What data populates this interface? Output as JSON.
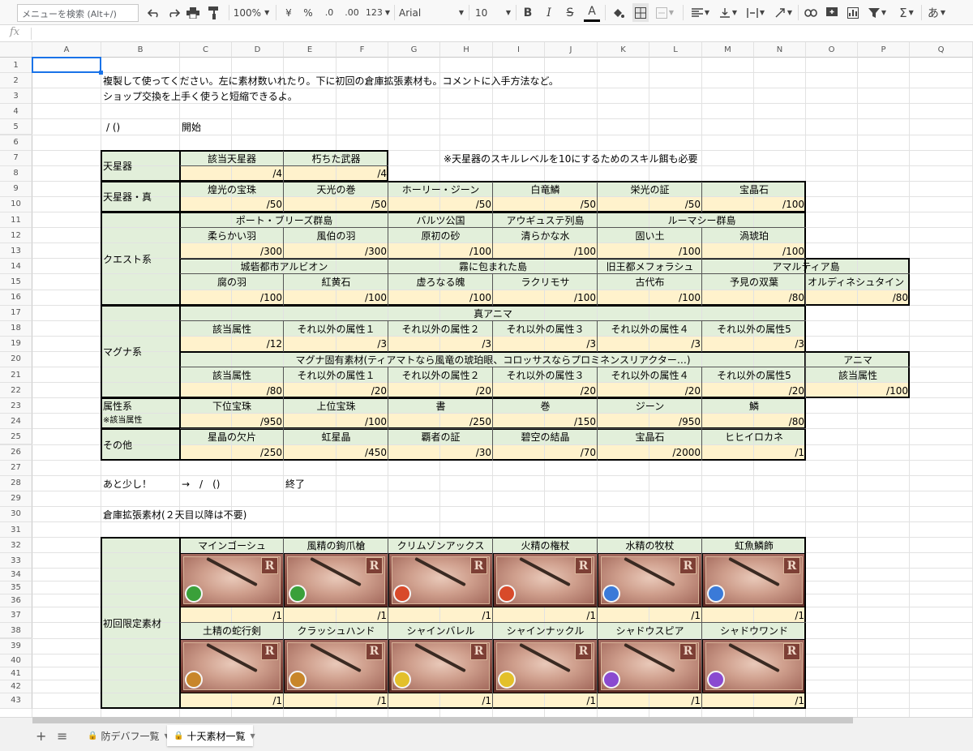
{
  "toolbar": {
    "search_placeholder": "メニューを検索 (Alt+/)",
    "zoom": "100%",
    "currency": "¥",
    "percent": "%",
    "dec_less": ".0",
    "dec_more": ".00",
    "format_more": "123",
    "font": "Arial",
    "font_size": "10",
    "bold": "B",
    "italic": "I",
    "strike": "S",
    "text_color": "A",
    "sigma": "Σ",
    "input_tool": "あ"
  },
  "formula_bar": {
    "fx": "fx"
  },
  "columns": [
    "A",
    "B",
    "C",
    "D",
    "E",
    "F",
    "G",
    "H",
    "I",
    "J",
    "K",
    "L",
    "M",
    "N",
    "O",
    "P",
    "Q"
  ],
  "rows": [
    "1",
    "2",
    "3",
    "4",
    "5",
    "6",
    "7",
    "8",
    "9",
    "10",
    "11",
    "12",
    "13",
    "14",
    "15",
    "16",
    "17",
    "18",
    "19",
    "20",
    "21",
    "22",
    "23",
    "24",
    "25",
    "26",
    "27",
    "28",
    "29",
    "30",
    "31",
    "32",
    "33",
    "34",
    "35",
    "36",
    "37",
    "38",
    "39",
    "40",
    "41",
    "42",
    "43"
  ],
  "cells": {
    "b2": "複製して使ってください。左に素材数いれたり。下に初回の倉庫拡張素材も。コメントに入手方法など。",
    "b3": "ショップ交換を上手く使うと短縮できるよ。",
    "b5": "/ ()",
    "c5": "開始",
    "b7": "天星器",
    "c7": "該当天星器",
    "e7": "朽ちた武器",
    "g7": "※天星器のスキルレベルを10にするためのスキル餌も必要",
    "d8": "/4",
    "f8": "/4",
    "b9": "天星器・真",
    "c9": "煌光の宝珠",
    "e9": "天光の巻",
    "g9": "ホーリー・ジーン",
    "i9": "白竜鱗",
    "k9": "栄光の証",
    "m9": "宝晶石",
    "d10": "/50",
    "f10": "/50",
    "h10": "/50",
    "j10": "/50",
    "l10": "/50",
    "n10": "/100",
    "c11": "ポート・ブリーズ群島",
    "g11": "バルツ公国",
    "i11": "アウギュステ列島",
    "k11": "ルーマシー群島",
    "c12": "柔らかい羽",
    "e12": "風伯の羽",
    "g12": "原初の砂",
    "i12": "清らかな水",
    "k12": "固い土",
    "m12": "渦琥珀",
    "b13": "クエスト系",
    "d13": "/300",
    "f13": "/300",
    "h13": "/100",
    "j13": "/100",
    "l13": "/100",
    "n13": "/100",
    "c14": "城砦都市アルビオン",
    "g14": "霧に包まれた島",
    "k14": "旧王都メフォラシュ",
    "m14": "アマルティア島",
    "c15": "腐の羽",
    "e15": "紅黄石",
    "g15": "虚ろなる魄",
    "i15": "ラクリモサ",
    "k15": "古代布",
    "m15": "予見の双葉",
    "o15": "オルディネシュタイン",
    "d16": "/100",
    "f16": "/100",
    "h16": "/100",
    "j16": "/100",
    "l16": "/100",
    "n16": "/80",
    "p16": "/80",
    "c17": "真アニマ",
    "b18": "マグナ系",
    "c18": "該当属性",
    "e18": "それ以外の属性１",
    "g18": "それ以外の属性２",
    "i18": "それ以外の属性３",
    "k18": "それ以外の属性４",
    "m18": "それ以外の属性5",
    "d19": "/12",
    "f19": "/3",
    "h19": "/3",
    "j19": "/3",
    "l19": "/3",
    "n19": "/3",
    "c20": "マグナ固有素材(ティアマトなら風竜の琥珀眼、コロッサスならプロミネンスリアクター…)",
    "o20": "アニマ",
    "c21": "該当属性",
    "e21": "それ以外の属性１",
    "g21": "それ以外の属性２",
    "i21": "それ以外の属性３",
    "k21": "それ以外の属性４",
    "m21": "それ以外の属性5",
    "o21": "該当属性",
    "d22": "/80",
    "f22": "/20",
    "h22": "/20",
    "j22": "/20",
    "l22": "/20",
    "n22": "/20",
    "p22": "/100",
    "b23": "属性系",
    "b24": "※該当属性",
    "c23": "下位宝珠",
    "e23": "上位宝珠",
    "g23": "書",
    "i23": "巻",
    "k23": "ジーン",
    "m23": "鱗",
    "d24": "/950",
    "f24": "/100",
    "h24": "/250",
    "j24": "/150",
    "l24": "/950",
    "n24": "/80",
    "b25": "その他",
    "c25": "星晶の欠片",
    "e25": "虹星晶",
    "g25": "覇者の証",
    "i25": "碧空の結晶",
    "k25": "宝晶石",
    "m25": "ヒヒイロカネ",
    "d26": "/250",
    "f26": "/450",
    "h26": "/30",
    "j26": "/70",
    "l26": "/2000",
    "n26": "/1",
    "b28": "あと少し！",
    "c28": "→　/　()",
    "e28": "終了",
    "b30": "倉庫拡張素材(２天目以降は不要)",
    "b40": "初回限定素材",
    "c32": "マインゴーシュ",
    "e32": "風精の鉤爪槍",
    "g32": "クリムゾンアックス",
    "i32": "火精の権杖",
    "k32": "水精の牧杖",
    "m32": "虹魚鱗飾",
    "d37": "/1",
    "f37": "/1",
    "h37": "/1",
    "j37": "/1",
    "l37": "/1",
    "n37": "/1",
    "c38": "土精の蛇行剣",
    "e38": "クラッシュハンド",
    "g38": "シャインバレル",
    "i38": "シャインナックル",
    "k38": "シャドウスピア",
    "m38": "シャドウワンド",
    "d43": "/1",
    "f43": "/1",
    "h43": "/1",
    "j43": "/1",
    "l43": "/1",
    "n43": "/1"
  },
  "rank_letter": "R",
  "weapon_icons_row1": [
    {
      "icon": "mainгauche-weapon-icon",
      "element": "wind",
      "color": "#3aa03a"
    },
    {
      "icon": "spear-weapon-icon",
      "element": "wind",
      "color": "#3aa03a"
    },
    {
      "icon": "axe-weapon-icon",
      "element": "fire",
      "color": "#d84a2a"
    },
    {
      "icon": "staff-weapon-icon",
      "element": "fire",
      "color": "#d84a2a"
    },
    {
      "icon": "staff-weapon-icon",
      "element": "water",
      "color": "#3a7ad8"
    },
    {
      "icon": "gun-weapon-icon",
      "element": "water",
      "color": "#3a7ad8"
    }
  ],
  "weapon_icons_row2": [
    {
      "icon": "sword-weapon-icon",
      "element": "earth",
      "color": "#c8862a"
    },
    {
      "icon": "gauntlet-weapon-icon",
      "element": "earth",
      "color": "#c8862a"
    },
    {
      "icon": "gun-weapon-icon",
      "element": "light",
      "color": "#e3c02a"
    },
    {
      "icon": "knuckle-weapon-icon",
      "element": "light",
      "color": "#e3c02a"
    },
    {
      "icon": "spear-weapon-icon",
      "element": "dark",
      "color": "#8a4ad0"
    },
    {
      "icon": "wand-weapon-icon",
      "element": "dark",
      "color": "#8a4ad0"
    }
  ],
  "sheet_tabs": {
    "add": "+",
    "list": "≡",
    "tab1": "防デバフ一覧",
    "tab2": "十天素材一覧"
  },
  "colors": {
    "green": "#e2efda",
    "yellow": "#fff2cc",
    "selected": "#1a73e8"
  }
}
